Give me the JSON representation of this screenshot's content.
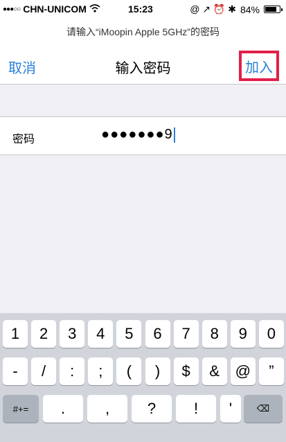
{
  "status_bar": {
    "signal": "●●●○○",
    "carrier": "CHN-UNICOM",
    "wifi_icon": "wifi",
    "time": "15:23",
    "right_icons": "@ ↗ ⏰ ✱",
    "battery_percent": "84%",
    "battery_level": 0.84
  },
  "prompt": "请输入“iMoopin Apple 5GHz”的密码",
  "nav": {
    "cancel": "取消",
    "title": "输入密码",
    "join": "加入",
    "highlight_color": "#e0204a",
    "accent_color": "#2a7fd6"
  },
  "password_row": {
    "label": "密码",
    "masked_value": "●●●●●●●9"
  },
  "keyboard": {
    "row1": [
      "1",
      "2",
      "3",
      "4",
      "5",
      "6",
      "7",
      "8",
      "9",
      "0"
    ],
    "row2": [
      "-",
      "/",
      ":",
      ";",
      "(",
      ")",
      "$",
      "&",
      "@",
      "”"
    ],
    "row3": [
      "#+=",
      ".",
      ",",
      "?",
      "!",
      "'",
      "⌫"
    ]
  }
}
